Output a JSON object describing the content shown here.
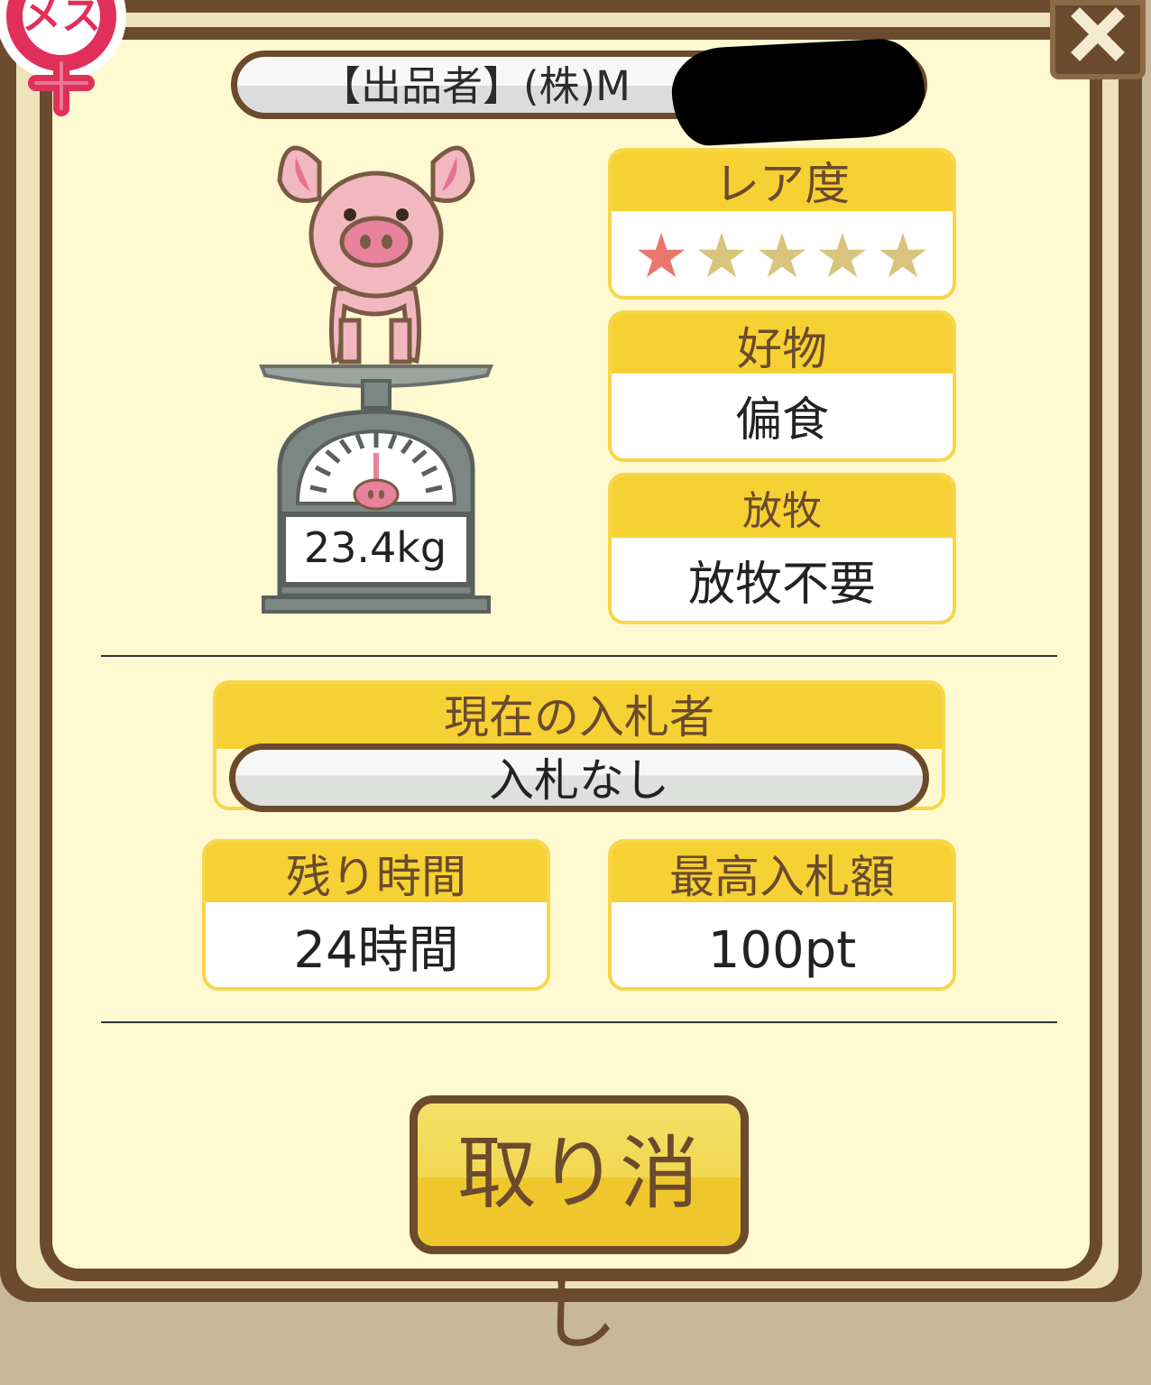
{
  "colors": {
    "frame": "#6b4a2d",
    "panel": "#fff9d2",
    "label_yellow": "#f6d133",
    "star_active": "#e8786e",
    "star_inactive": "#d8c47c"
  },
  "gender_badge": {
    "label": "メス",
    "icon": "female-symbol-icon"
  },
  "seller": {
    "label": "【出品者】(株)M"
  },
  "pig": {
    "weight": "23.4kg"
  },
  "rarity": {
    "label": "レア度",
    "value": 1,
    "max": 5
  },
  "favorite_food": {
    "label": "好物",
    "value": "偏食"
  },
  "grazing": {
    "label": "放牧",
    "value": "放牧不要"
  },
  "current_bidder": {
    "label": "現在の入札者",
    "value": "入札なし"
  },
  "remaining_time": {
    "label": "残り時間",
    "value": "24時間"
  },
  "highest_bid": {
    "label": "最高入札額",
    "value": "100pt"
  },
  "cancel_button": {
    "label": "取り消し"
  },
  "close_button": {
    "icon": "close-icon"
  }
}
